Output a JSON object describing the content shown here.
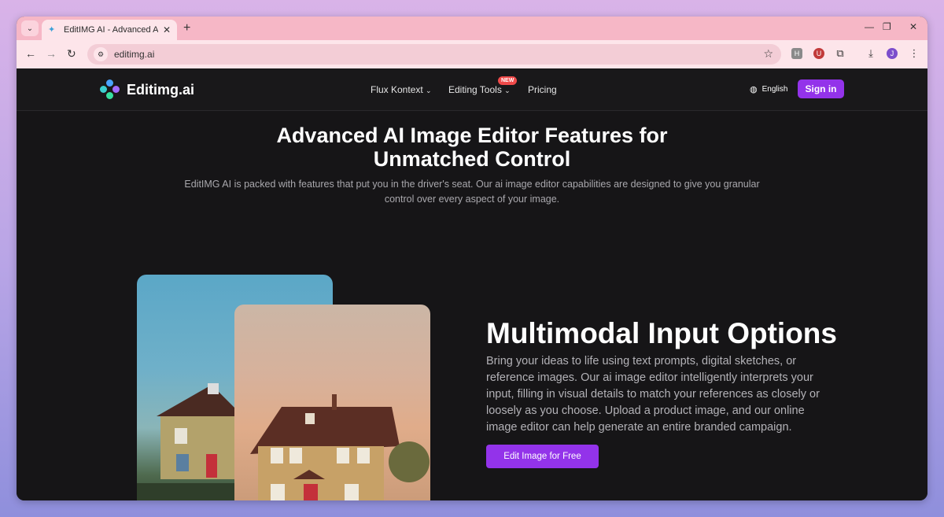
{
  "browser": {
    "tab_title": "EditIMG AI - Advanced AI Imag",
    "url": "editimg.ai",
    "profile_initial": "J",
    "ext_h": "H",
    "ext_u": "U"
  },
  "nav": {
    "logo_text": "Editimg.ai",
    "items": [
      {
        "label": "Flux Kontext"
      },
      {
        "label": "Editing Tools"
      },
      {
        "label": "Pricing"
      }
    ],
    "badge": "NEW",
    "language": "English",
    "signin": "Sign in"
  },
  "hero": {
    "title_line1": "Advanced AI Image Editor Features for",
    "title_line2": "Unmatched Control",
    "subtitle_line1": "EditIMG AI is packed with features that put you in the driver's seat. Our ai image editor capabilities are designed to give you granular",
    "subtitle_line2": "control over every aspect of your image."
  },
  "feature": {
    "title": "Multimodal Input Options",
    "description": "Bring your ideas to life using text prompts, digital sketches, or reference images. Our ai image editor intelligently interprets your input, filling in visual details to match your references as closely or loosely as you choose. Upload a product image, and our online image editor can help generate an entire branded campaign.",
    "cta": "Edit Image for Free"
  },
  "colors": {
    "accent": "#9333ea",
    "background": "#161517",
    "badge": "#ef4a4a"
  }
}
